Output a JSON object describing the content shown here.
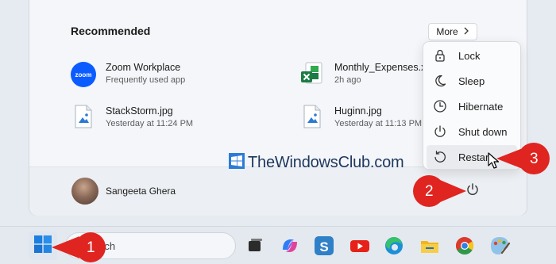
{
  "start_menu": {
    "recommended_title": "Recommended",
    "more_label": "More",
    "items": [
      {
        "name": "Zoom Workplace",
        "subtitle": "Frequently used app",
        "icon": "zoom-app-icon",
        "icon_text": "zoom"
      },
      {
        "name": "Monthly_Expenses.xl",
        "subtitle": "2h ago",
        "icon": "excel-file-icon"
      },
      {
        "name": "StackStorm.jpg",
        "subtitle": "Yesterday at 11:24 PM",
        "icon": "image-file-icon"
      },
      {
        "name": "Huginn.jpg",
        "subtitle": "Yesterday at 11:13 PM",
        "icon": "image-file-icon"
      }
    ],
    "user_name": "Sangeeta Ghera"
  },
  "power_menu": {
    "items": [
      {
        "label": "Lock",
        "icon": "lock-icon"
      },
      {
        "label": "Sleep",
        "icon": "moon-icon"
      },
      {
        "label": "Hibernate",
        "icon": "clock-icon"
      },
      {
        "label": "Shut down",
        "icon": "power-icon"
      },
      {
        "label": "Restart",
        "icon": "restart-icon"
      }
    ],
    "hovered": "Restart"
  },
  "watermark": {
    "text": "TheWindowsClub.com"
  },
  "callouts": [
    "1",
    "2",
    "3"
  ],
  "taskbar": {
    "search_placeholder": "rch",
    "apps": [
      "task-view-icon",
      "copilot-icon",
      "s-app-icon",
      "youtube-icon",
      "edge-icon",
      "file-explorer-icon",
      "chrome-icon",
      "paint-icon"
    ]
  },
  "colors": {
    "callout_red": "#e02420",
    "accent_blue": "#1c6fd4",
    "excel_green": "#1e7b46",
    "zoom_blue": "#0b5cff"
  }
}
